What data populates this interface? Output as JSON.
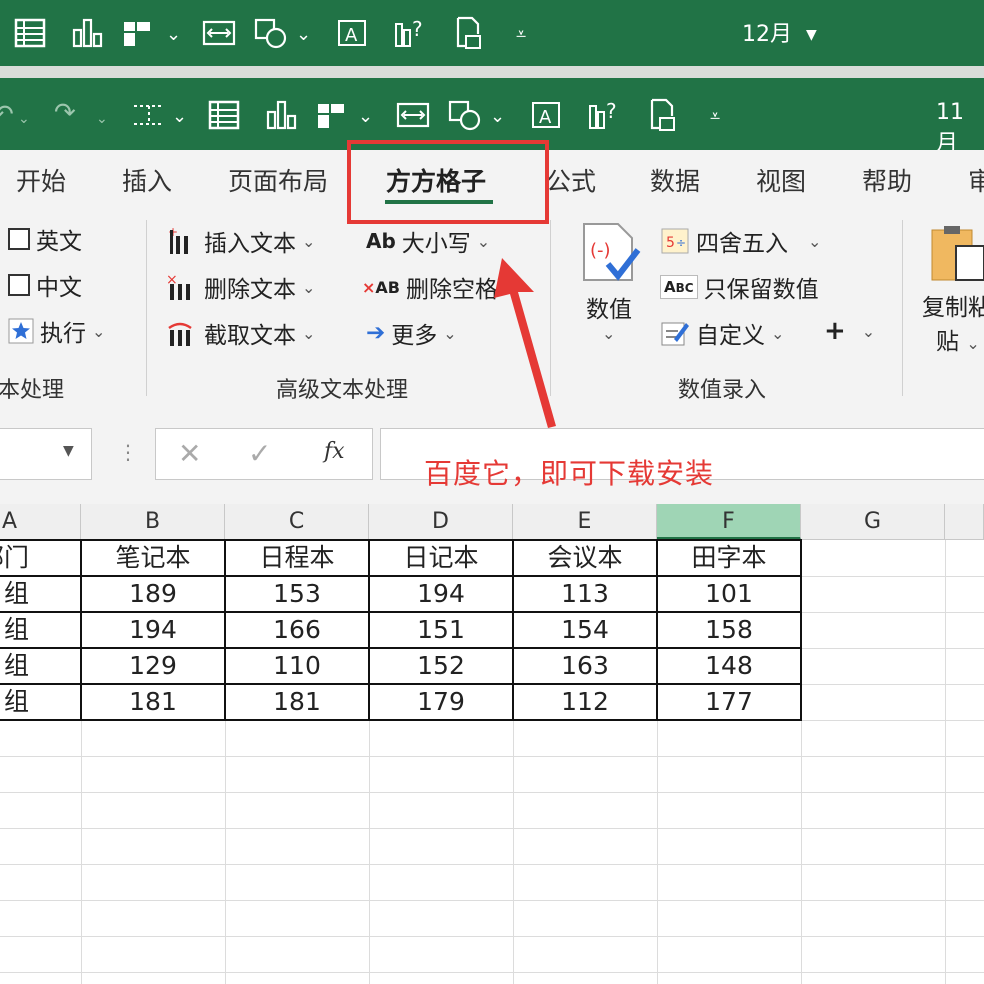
{
  "top_window": {
    "title": "12月"
  },
  "window": {
    "title": "11月"
  },
  "tabs": [
    "开始",
    "插入",
    "页面布局",
    "方方格子",
    "公式",
    "数据",
    "视图",
    "帮助",
    "审"
  ],
  "ribbon": {
    "text_group": {
      "label": "本处理",
      "items": [
        "英文",
        "中文",
        "执行"
      ]
    },
    "advanced_group": {
      "label": "高级文本处理",
      "items": [
        "插入文本",
        "删除文本",
        "截取文本",
        "大小写",
        "删除空格",
        "更多"
      ]
    },
    "number_group": {
      "label": "数值录入",
      "big_button": "数值",
      "items": [
        "四舍五入",
        "只保留数值",
        "自定义"
      ]
    },
    "copy_group": {
      "label_line1": "复制粘",
      "label_line2": "贴"
    }
  },
  "formula_bar": {
    "fx": "fx",
    "value": ""
  },
  "annotation": "百度它，即可下载安装",
  "sheet": {
    "columns": [
      "A",
      "B",
      "C",
      "D",
      "E",
      "F",
      "G"
    ],
    "selected_column": "F",
    "header": [
      "部门",
      "笔记本",
      "日程本",
      "日记本",
      "会议本",
      "田字本"
    ],
    "rows": [
      [
        "组",
        "189",
        "153",
        "194",
        "113",
        "101"
      ],
      [
        "组",
        "194",
        "166",
        "151",
        "154",
        "158"
      ],
      [
        "组",
        "129",
        "110",
        "152",
        "163",
        "148"
      ],
      [
        "组",
        "181",
        "181",
        "179",
        "112",
        "177"
      ]
    ]
  },
  "colors": {
    "excel_green": "#217346",
    "highlight_red": "#e53935",
    "selected_column": "#9fd5b5"
  }
}
